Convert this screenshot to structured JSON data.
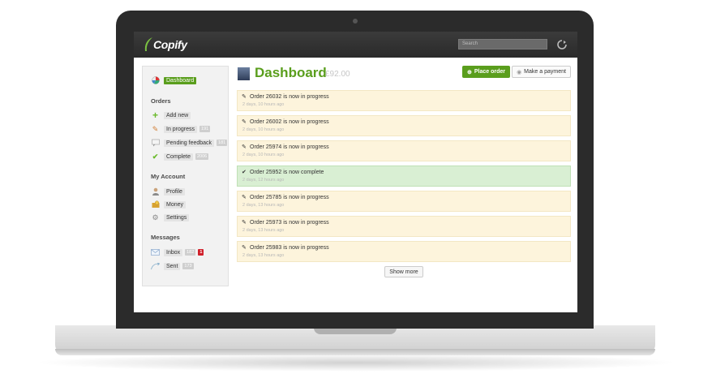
{
  "app": {
    "logo_text": "Copify"
  },
  "topbar": {
    "search_placeholder": "Search"
  },
  "sidebar": {
    "dashboard_label": "Dashboard",
    "orders_heading": "Orders",
    "orders": [
      {
        "label": "Add new",
        "count": ""
      },
      {
        "label": "In progress",
        "count": "191"
      },
      {
        "label": "Pending feedback",
        "count": "181"
      },
      {
        "label": "Complete",
        "count": "2006"
      }
    ],
    "account_heading": "My Account",
    "account": [
      {
        "label": "Profile"
      },
      {
        "label": "Money"
      },
      {
        "label": "Settings"
      }
    ],
    "messages_heading": "Messages",
    "messages": [
      {
        "label": "Inbox",
        "count": "182",
        "unread": "1"
      },
      {
        "label": "Sent",
        "count": "173"
      }
    ]
  },
  "main": {
    "title": "Dashboard",
    "balance": "£92.00",
    "place_order_label": "Place order",
    "make_payment_label": "Make a payment",
    "show_more_label": "Show more",
    "feed": [
      {
        "text": "Order 26032 is now in progress",
        "time": "2 days, 10 hours ago",
        "status": "progress"
      },
      {
        "text": "Order 26002 is now in progress",
        "time": "2 days, 10 hours ago",
        "status": "progress"
      },
      {
        "text": "Order 25974 is now in progress",
        "time": "2 days, 10 hours ago",
        "status": "progress"
      },
      {
        "text": "Order 25952 is now complete",
        "time": "2 days, 12 hours ago",
        "status": "complete"
      },
      {
        "text": "Order 25785 is now in progress",
        "time": "2 days, 13 hours ago",
        "status": "progress"
      },
      {
        "text": "Order 25973 is now in progress",
        "time": "2 days, 13 hours ago",
        "status": "progress"
      },
      {
        "text": "Order 25983 is now in progress",
        "time": "2 days, 13 hours ago",
        "status": "progress"
      }
    ]
  },
  "colors": {
    "brand_green": "#5a9e1d",
    "progress_bg": "#fdf4dc",
    "complete_bg": "#d9efd3",
    "badge_red": "#d0202a"
  }
}
